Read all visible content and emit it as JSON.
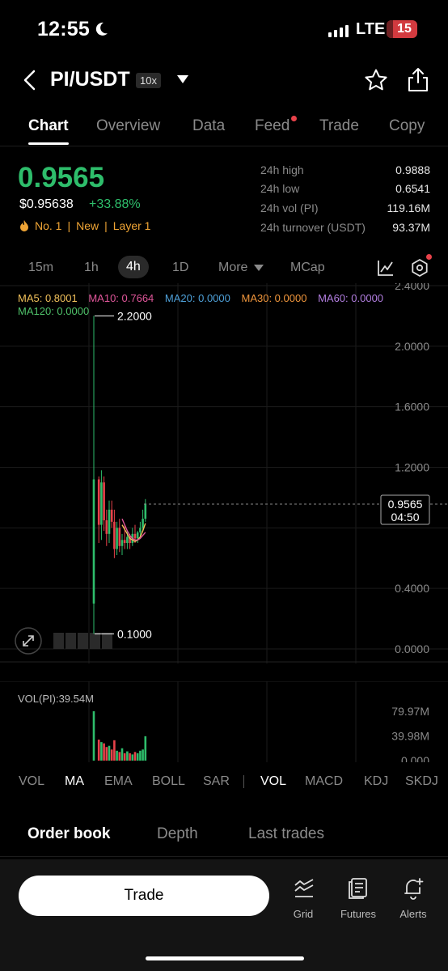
{
  "status": {
    "time": "12:55",
    "network": "LTE",
    "battery": "15"
  },
  "header": {
    "pair": "PI/USDT",
    "leverage": "10x"
  },
  "tabs": [
    "Chart",
    "Overview",
    "Data",
    "Feed",
    "Trade",
    "Copy"
  ],
  "price": {
    "last": "0.9565",
    "usd": "$0.95638",
    "change": "+33.88%",
    "tags": [
      "No. 1",
      "New",
      "Layer 1"
    ],
    "stats": [
      {
        "label": "24h high",
        "value": "0.9888"
      },
      {
        "label": "24h low",
        "value": "0.6541"
      },
      {
        "label": "24h vol (PI)",
        "value": "119.16M"
      },
      {
        "label": "24h turnover (USDT)",
        "value": "93.37M"
      }
    ]
  },
  "intervals": [
    "15m",
    "1h",
    "4h",
    "1D",
    "More",
    "MCap"
  ],
  "ma_legend": [
    {
      "text": "MA5: 0.8001",
      "color": "#f0c05a"
    },
    {
      "text": "MA10: 0.7664",
      "color": "#e0569a"
    },
    {
      "text": "MA20: 0.0000",
      "color": "#4ea0d8"
    },
    {
      "text": "MA30: 0.0000",
      "color": "#f0963c"
    },
    {
      "text": "MA60: 0.0000",
      "color": "#b27ee0"
    },
    {
      "text": "MA120: 0.0000",
      "color": "#4fc26a"
    }
  ],
  "chart_data": {
    "type": "candlestick",
    "interval": "4h",
    "y_axis_labels": [
      "2.4000",
      "2.0000",
      "1.6000",
      "1.2000",
      "0.4000",
      "0.0000"
    ],
    "ylim": [
      0,
      2.4
    ],
    "high_marker": "2.2000",
    "low_marker": "0.1000",
    "last_price": "0.9565",
    "countdown": "04:50",
    "candles": [
      {
        "o": 0.3,
        "h": 2.2,
        "l": 0.1,
        "c": 1.12
      },
      {
        "o": 1.12,
        "h": 1.14,
        "l": 0.7,
        "c": 0.82
      },
      {
        "o": 0.82,
        "h": 1.18,
        "l": 0.72,
        "c": 1.1
      },
      {
        "o": 1.1,
        "h": 1.14,
        "l": 0.78,
        "c": 0.85
      },
      {
        "o": 0.85,
        "h": 0.92,
        "l": 0.68,
        "c": 0.76
      },
      {
        "o": 0.76,
        "h": 0.98,
        "l": 0.7,
        "c": 0.92
      },
      {
        "o": 0.92,
        "h": 0.98,
        "l": 0.8,
        "c": 0.84
      },
      {
        "o": 0.84,
        "h": 0.92,
        "l": 0.6,
        "c": 0.66
      },
      {
        "o": 0.66,
        "h": 0.84,
        "l": 0.62,
        "c": 0.8
      },
      {
        "o": 0.8,
        "h": 0.86,
        "l": 0.64,
        "c": 0.68
      },
      {
        "o": 0.68,
        "h": 0.76,
        "l": 0.62,
        "c": 0.72
      },
      {
        "o": 0.72,
        "h": 0.82,
        "l": 0.66,
        "c": 0.7
      },
      {
        "o": 0.7,
        "h": 0.78,
        "l": 0.66,
        "c": 0.74
      },
      {
        "o": 0.74,
        "h": 0.76,
        "l": 0.66,
        "c": 0.7
      },
      {
        "o": 0.7,
        "h": 0.8,
        "l": 0.68,
        "c": 0.76
      },
      {
        "o": 0.76,
        "h": 0.82,
        "l": 0.7,
        "c": 0.73
      },
      {
        "o": 0.73,
        "h": 0.78,
        "l": 0.7,
        "c": 0.77
      },
      {
        "o": 0.77,
        "h": 0.84,
        "l": 0.74,
        "c": 0.8
      },
      {
        "o": 0.8,
        "h": 0.92,
        "l": 0.78,
        "c": 0.86
      },
      {
        "o": 0.86,
        "h": 0.99,
        "l": 0.84,
        "c": 0.96
      }
    ],
    "ma5": [
      0.82,
      0.79,
      0.76,
      0.73,
      0.72,
      0.71,
      0.72,
      0.74,
      0.78,
      0.83
    ],
    "ma10": [
      0.86,
      0.82,
      0.78,
      0.75,
      0.73,
      0.72,
      0.72,
      0.73,
      0.75,
      0.77
    ],
    "volume": {
      "label": "VOL(PI):39.54M",
      "axis_labels": [
        "79.97M",
        "39.98M",
        "0.000"
      ],
      "max": 79.97,
      "values": [
        80,
        34,
        30,
        28,
        22,
        24,
        18,
        33,
        16,
        14,
        20,
        12,
        15,
        12,
        10,
        14,
        12,
        16,
        18,
        39.54
      ]
    }
  },
  "indicators": {
    "main": [
      "VOL",
      "MA",
      "EMA",
      "BOLL",
      "SAR"
    ],
    "sub": [
      "VOL",
      "MACD",
      "KDJ",
      "SKDJ"
    ]
  },
  "orderbook_tabs": [
    "Order book",
    "Depth",
    "Last trades"
  ],
  "bottom_bar": {
    "trade": "Trade",
    "items": [
      "Grid",
      "Futures",
      "Alerts"
    ]
  },
  "colors": {
    "up": "#2ebd6b",
    "down": "#e8424a",
    "accent_tag": "#f0a535"
  }
}
